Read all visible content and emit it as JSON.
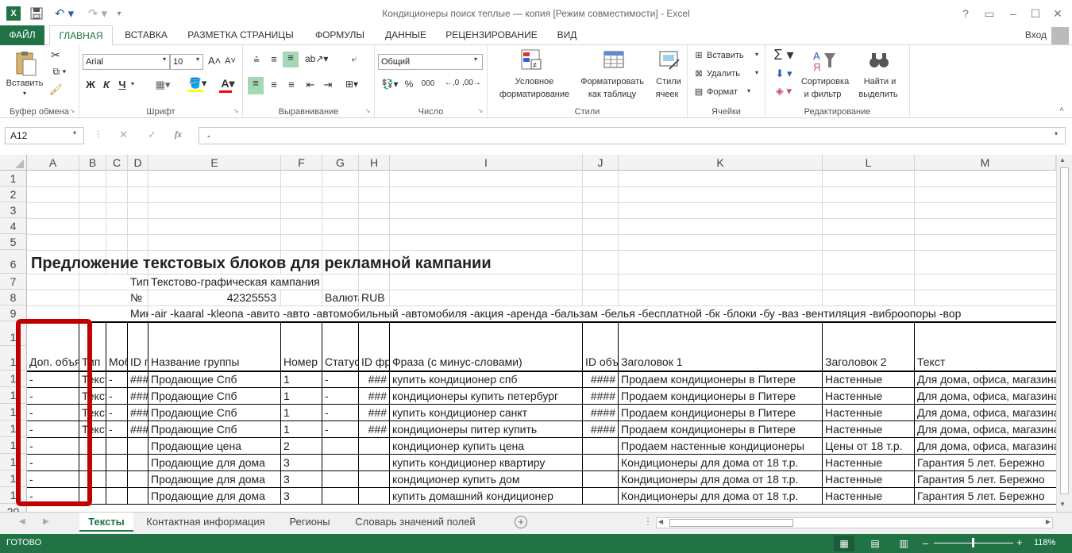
{
  "window": {
    "title": "Кондиционеры поиск теплые — копия  [Режим совместимости] - Excel",
    "help": "?",
    "sign_in": "Вход"
  },
  "tabs": [
    {
      "label": "ФАЙЛ"
    },
    {
      "label": "ГЛАВНАЯ"
    },
    {
      "label": "ВСТАВКА"
    },
    {
      "label": "РАЗМЕТКА СТРАНИЦЫ"
    },
    {
      "label": "ФОРМУЛЫ"
    },
    {
      "label": "ДАННЫЕ"
    },
    {
      "label": "РЕЦЕНЗИРОВАНИЕ"
    },
    {
      "label": "ВИД"
    }
  ],
  "ribbon": {
    "clipboard": {
      "paste": "Вставить",
      "label": "Буфер обмена"
    },
    "font": {
      "name": "Arial",
      "size": "10",
      "bold": "Ж",
      "italic": "К",
      "underline": "Ч",
      "label": "Шрифт"
    },
    "alignment": {
      "label": "Выравнивание"
    },
    "number": {
      "format": "Общий",
      "label": "Число",
      "thousands": "000"
    },
    "styles": {
      "conditional_1": "Условное",
      "conditional_2": "форматирование",
      "table_1": "Форматировать",
      "table_2": "как таблицу",
      "cell_1": "Стили",
      "cell_2": "ячеек",
      "label": "Стили"
    },
    "cells": {
      "insert": "Вставить",
      "delete": "Удалить",
      "format": "Формат",
      "label": "Ячейки"
    },
    "editing": {
      "sort_1": "Сортировка",
      "sort_2": "и фильтр",
      "find_1": "Найти и",
      "find_2": "выделить",
      "label": "Редактирование"
    }
  },
  "formula_bar": {
    "name_box": "A12",
    "fx": "fx",
    "value": "-"
  },
  "columns": [
    "A",
    "B",
    "C",
    "D",
    "E",
    "F",
    "G",
    "H",
    "I",
    "J",
    "K",
    "L",
    "M"
  ],
  "rows": [
    "1",
    "2",
    "3",
    "4",
    "5",
    "6",
    "7",
    "8",
    "9",
    "1",
    "1",
    "1",
    "1",
    "1",
    "1",
    "1",
    "1",
    "1",
    "1",
    "20"
  ],
  "sheet": {
    "title": "Предложение текстовых блоков для рекламной кампании",
    "row7": {
      "d": "Тип",
      "e": "Текстово-графическая кампания"
    },
    "row8": {
      "d": "№",
      "e": "42325553",
      "g": "Валюта",
      "h": "RUB"
    },
    "row9": {
      "d": "Минус",
      "e": "-air -kaaral -kleona -авито -авто -автомобильный -автомобиля -акция -аренда -бальзам -белья -бесплатной -бк -блоки -бу -ваз -вентиляция -виброопоры -вор"
    },
    "headers": {
      "a": "Доп. объявление",
      "b": "Тип",
      "c": "Мобильное",
      "d": "ID группы",
      "e": "Название группы",
      "f": "Номер",
      "g": "Статус",
      "h": "ID фразы",
      "i": "Фраза (с минус-словами)",
      "j": "ID объявления",
      "k": "Заголовок 1",
      "l": "Заголовок 2",
      "m": "Текст"
    },
    "data_rows": [
      {
        "a": "-",
        "b": "Текстовое",
        "c": "-",
        "d": "###",
        "e": "Продающие Спб",
        "f": "1",
        "g": "-",
        "h": "###",
        "i": "купить кондиционер спб",
        "j": "####",
        "k": "Продаем кондиционеры в Питере",
        "l": "Настенные",
        "m": "Для дома, офиса, магазина"
      },
      {
        "a": "-",
        "b": "Текстовое",
        "c": "-",
        "d": "###",
        "e": "Продающие Спб",
        "f": "1",
        "g": "-",
        "h": "###",
        "i": "кондиционеры купить петербург",
        "j": "####",
        "k": "Продаем кондиционеры в Питере",
        "l": "Настенные",
        "m": "Для дома, офиса, магазина"
      },
      {
        "a": "-",
        "b": "Текстовое",
        "c": "-",
        "d": "###",
        "e": "Продающие Спб",
        "f": "1",
        "g": "-",
        "h": "###",
        "i": "купить кондиционер санкт",
        "j": "####",
        "k": "Продаем кондиционеры в Питере",
        "l": "Настенные",
        "m": "Для дома, офиса, магазина"
      },
      {
        "a": "-",
        "b": "Текстовое",
        "c": "-",
        "d": "###",
        "e": "Продающие Спб",
        "f": "1",
        "g": "-",
        "h": "###",
        "i": "кондиционеры питер купить",
        "j": "####",
        "k": "Продаем кондиционеры в Питере",
        "l": "Настенные",
        "m": "Для дома, офиса, магазина"
      },
      {
        "a": "-",
        "b": "",
        "c": "",
        "d": "",
        "e": "Продающие цена",
        "f": "2",
        "g": "",
        "h": "",
        "i": "кондиционер купить цена",
        "j": "",
        "k": "Продаем настенные кондиционеры",
        "l": "Цены от 18 т.р.",
        "m": "Для дома, офиса, магазина"
      },
      {
        "a": "-",
        "b": "",
        "c": "",
        "d": "",
        "e": "Продающие для дома",
        "f": "3",
        "g": "",
        "h": "",
        "i": "купить кондиционер квартиру",
        "j": "",
        "k": "Кондиционеры для дома от 18 т.р.",
        "l": "Настенные",
        "m": "Гарантия 5 лет. Бережно"
      },
      {
        "a": "-",
        "b": "",
        "c": "",
        "d": "",
        "e": "Продающие для дома",
        "f": "3",
        "g": "",
        "h": "",
        "i": "кондиционер купить дом",
        "j": "",
        "k": "Кондиционеры для дома от 18 т.р.",
        "l": "Настенные",
        "m": "Гарантия 5 лет. Бережно"
      },
      {
        "a": "-",
        "b": "",
        "c": "",
        "d": "",
        "e": "Продающие для дома",
        "f": "3",
        "g": "",
        "h": "",
        "i": "купить домашний кондиционер",
        "j": "",
        "k": "Кондиционеры для дома от 18 т.р.",
        "l": "Настенные",
        "m": "Гарантия 5 лет. Бережно"
      }
    ]
  },
  "sheet_tabs": [
    {
      "label": "Тексты"
    },
    {
      "label": "Контактная информация"
    },
    {
      "label": "Регионы"
    },
    {
      "label": "Словарь значений полей"
    }
  ],
  "status": {
    "ready": "ГОТОВО",
    "zoom": "118%"
  },
  "colors": {
    "excel_green": "#217346",
    "highlight": "#c00000"
  }
}
